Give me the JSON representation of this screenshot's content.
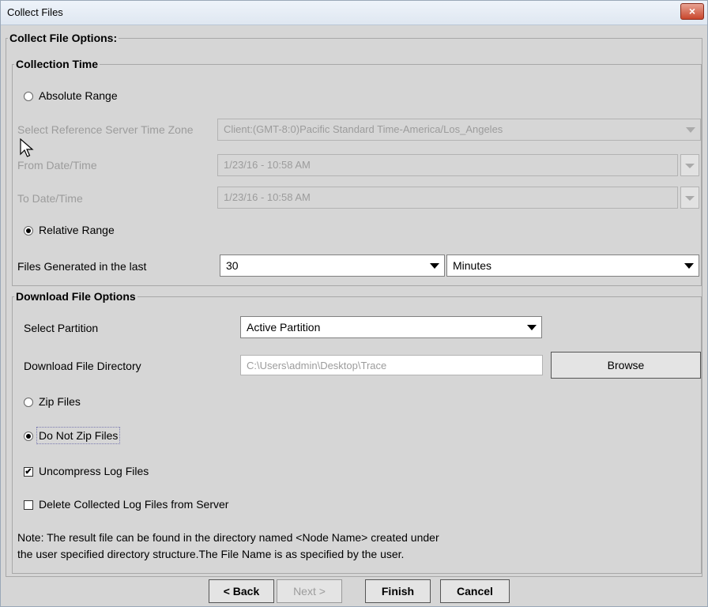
{
  "window": {
    "title": "Collect Files",
    "close": "×"
  },
  "options_legend": "Collect File Options:",
  "collection": {
    "legend": "Collection Time",
    "absolute_range": "Absolute Range",
    "tz_label": "Select Reference Server Time Zone",
    "tz_value": "Client:(GMT-8:0)Pacific Standard Time-America/Los_Angeles",
    "from_label": "From Date/Time",
    "from_value": "1/23/16 - 10:58 AM",
    "to_label": "To Date/Time",
    "to_value": "1/23/16 - 10:58 AM",
    "relative_range": "Relative Range",
    "files_label": "Files Generated in the last",
    "files_value": "30",
    "unit_value": "Minutes"
  },
  "download": {
    "legend": "Download File Options",
    "partition_label": "Select Partition",
    "partition_value": "Active Partition",
    "dir_label": "Download File Directory",
    "dir_value": "C:\\Users\\admin\\Desktop\\Trace",
    "browse": "Browse",
    "zip": "Zip Files",
    "nozip": "Do Not Zip Files",
    "uncompress": "Uncompress Log Files",
    "uncompress_check": "✔",
    "delete": "Delete Collected Log Files from Server",
    "note_line1": "Note: The result file can be found in the directory named <Node Name> created under",
    "note_line2": "the user specified directory structure.The File Name is as specified by the user."
  },
  "buttons": {
    "back": "< Back",
    "next": "Next >",
    "finish": "Finish",
    "cancel": "Cancel"
  }
}
